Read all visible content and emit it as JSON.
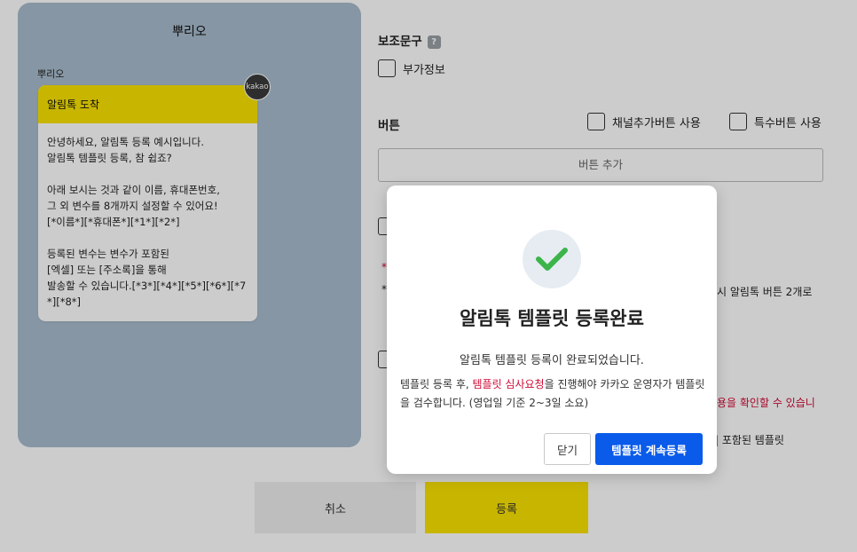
{
  "preview": {
    "channel_name": "뿌리오",
    "sender_name": "뿌리오",
    "kakao_badge": "kakao",
    "bubble_header": "알림톡 도착",
    "bubble_body": "안녕하세요, 알림톡 등록 예시입니다.\n알림톡 템플릿 등록, 참 쉽죠?\n\n아래 보시는 것과 같이 이름, 휴대폰번호,\n그 외 변수를 8개까지 설정할 수 있어요!\n[*이름*][*휴대폰*][*1*][*2*]\n\n등록된 변수는 변수가 포함된\n[엑셀] 또는 [주소록]을 통해\n발송할 수 있습니다.[*3*][*4*][*5*][*6*][*7*][*8*]"
  },
  "form": {
    "sub_text_title": "보조문구",
    "help_glyph": "?",
    "extra_info_label": "부가정보",
    "button_section_title": "버튼",
    "channel_add_button_label": "채널추가버튼 사용",
    "special_button_label": "특수버튼 사용",
    "add_button_label": "버튼 추가",
    "partial_bullet_1": "*",
    "partial_bullet_2": "*",
    "partial_text_1": "시 알림톡 버튼 2개로",
    "partial_text_2": "용을 확인할 수 있습니",
    "partial_text_3": "| 포함된 템플릿",
    "cancel_label": "취소",
    "register_label": "등록"
  },
  "modal": {
    "title": "알림톡 템플릿 등록완료",
    "message": "알림톡 템플릿 등록이 완료되었습니다.",
    "notice_prefix": "템플릿 등록 후, ",
    "notice_highlight": "템플릿 심사요청",
    "notice_suffix": "을 진행해야 카카오 운영자가 템플릿을 검수합니다. (영업일 기준 2~3일 소요)",
    "close_label": "닫기",
    "continue_label": "템플릿 계속등록"
  },
  "colors": {
    "kakao_yellow": "#fbe300",
    "primary_blue": "#0a5bea",
    "highlight_red": "#d10a35",
    "success_green": "#3cb44a"
  }
}
